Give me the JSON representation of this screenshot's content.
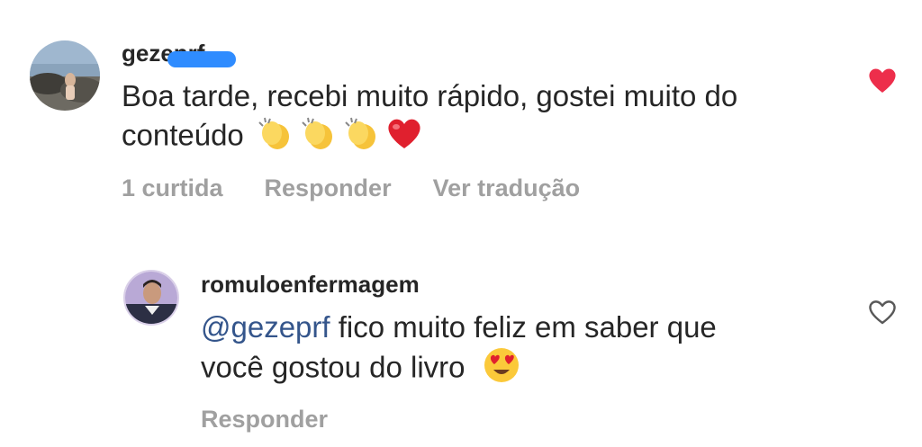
{
  "comments": [
    {
      "username": "gezeprf",
      "text_line1": "Boa tarde, recebi muito rápido, gostei muito do",
      "text_line2": "conteúdo",
      "like_count": "1 curtida",
      "reply_label": "Responder",
      "translate_label": "Ver tradução",
      "liked": true,
      "heart_color": "#ed2e4b",
      "emojis": [
        "clapping-hands",
        "clapping-hands",
        "clapping-hands",
        "red-heart"
      ]
    }
  ],
  "reply": {
    "username": "romuloenfermagem",
    "mention": "@gezeprf",
    "text_line1": " fico muito feliz em saber que",
    "text_line2": "você gostou do livro",
    "reply_label": "Responder",
    "liked": false,
    "mention_color": "#34558b",
    "emoji": "heart-eyes-face"
  }
}
